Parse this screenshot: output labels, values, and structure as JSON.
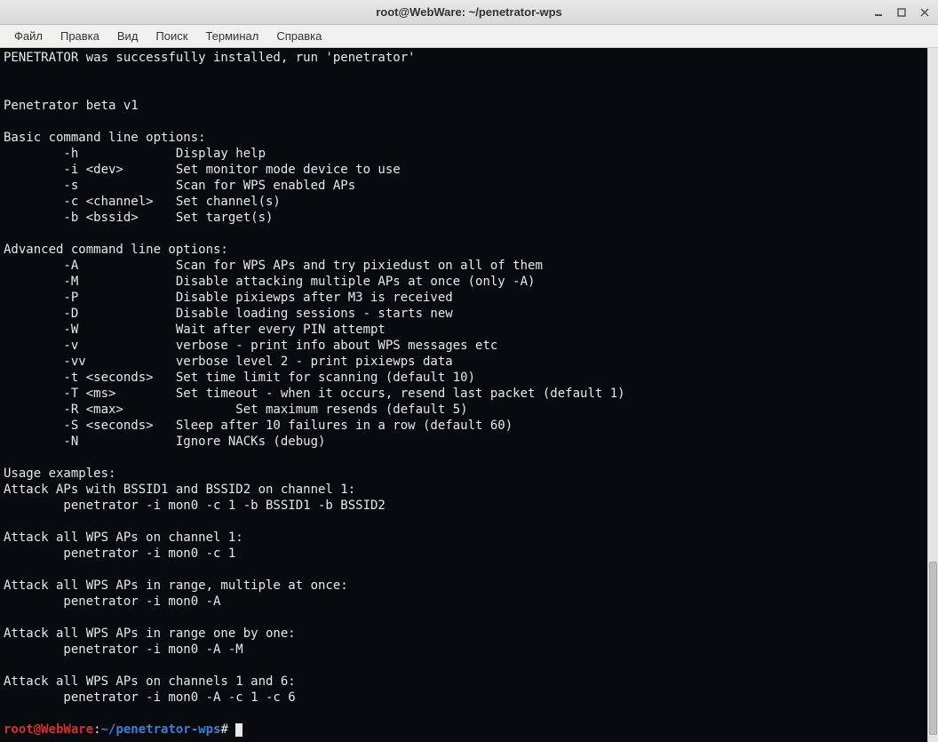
{
  "window": {
    "title": "root@WebWare: ~/penetrator-wps"
  },
  "menu": {
    "file": "Файл",
    "edit": "Правка",
    "view": "Вид",
    "search": "Поиск",
    "terminal": "Терминал",
    "help": "Справка"
  },
  "term": {
    "line_installed": "PENETRATOR was successfully installed, run 'penetrator'",
    "blank": "",
    "version": "Penetrator beta v1",
    "basic_hdr": "Basic command line options:",
    "opt_h": "        -h             Display help",
    "opt_i": "        -i <dev>       Set monitor mode device to use",
    "opt_s": "        -s             Scan for WPS enabled APs",
    "opt_c": "        -c <channel>   Set channel(s)",
    "opt_b": "        -b <bssid>     Set target(s)",
    "adv_hdr": "Advanced command line options:",
    "opt_A": "        -A             Scan for WPS APs and try pixiedust on all of them",
    "opt_M": "        -M             Disable attacking multiple APs at once (only -A)",
    "opt_P": "        -P             Disable pixiewps after M3 is received",
    "opt_D": "        -D             Disable loading sessions - starts new",
    "opt_W": "        -W             Wait after every PIN attempt",
    "opt_v": "        -v             verbose - print info about WPS messages etc",
    "opt_vv": "        -vv            verbose level 2 - print pixiewps data",
    "opt_t": "        -t <seconds>   Set time limit for scanning (default 10)",
    "opt_T": "        -T <ms>        Set timeout - when it occurs, resend last packet (default 1)",
    "opt_R": "        -R <max>               Set maximum resends (default 5)",
    "opt_S": "        -S <seconds>   Sleep after 10 failures in a row (default 60)",
    "opt_N": "        -N             Ignore NACKs (debug)",
    "usage_hdr": "Usage examples:",
    "ex1_hdr": "Attack APs with BSSID1 and BSSID2 on channel 1:",
    "ex1_cmd": "        penetrator -i mon0 -c 1 -b BSSID1 -b BSSID2",
    "ex2_hdr": "Attack all WPS APs on channel 1:",
    "ex2_cmd": "        penetrator -i mon0 -c 1",
    "ex3_hdr": "Attack all WPS APs in range, multiple at once:",
    "ex3_cmd": "        penetrator -i mon0 -A",
    "ex4_hdr": "Attack all WPS APs in range one by one:",
    "ex4_cmd": "        penetrator -i mon0 -A -M",
    "ex5_hdr": "Attack all WPS APs on channels 1 and 6:",
    "ex5_cmd": "        penetrator -i mon0 -A -c 1 -c 6"
  },
  "prompt": {
    "user": "root@WebWare",
    "colon": ":",
    "path": "~/penetrator-wps",
    "hash": "# "
  }
}
